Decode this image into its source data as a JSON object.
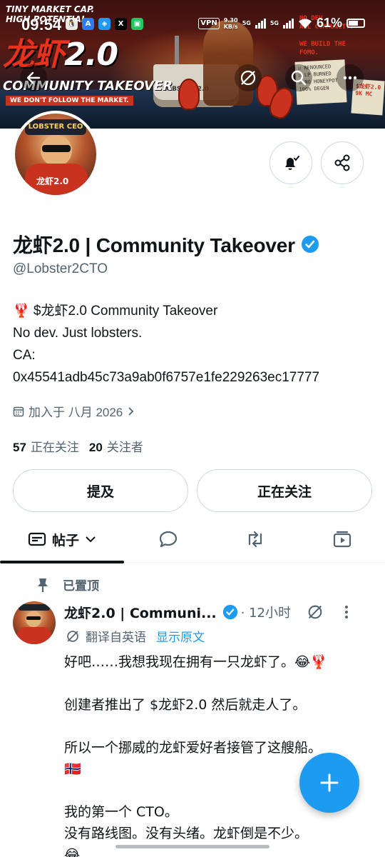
{
  "status_bar": {
    "time": "09:54",
    "apps": [
      "🐧",
      "A",
      "◈",
      "X",
      "▣"
    ],
    "vpn": "VPN",
    "speed_value": "9.30",
    "speed_unit": "KB/s",
    "net1": "5G",
    "net2": "5G",
    "battery": "61%"
  },
  "banner": {
    "tagline_top": "TINY MARKET CAP.\nHIGH POTENTIAL",
    "title_red": "龙虾",
    "title_white": "2.0",
    "subtitle": "COMMUNITY TAKEOVER",
    "redbar": "WE DON'T FOLLOW THE MARKET.",
    "notes": "NO DEV.\nALL COMMUNITY.\n\nWE BUILD THE FOMO.",
    "note_pad": "☑ RENOUNCED\n☑ LP BURNED\n☑ NO HONEYPOT\n100% DEGEN",
    "sticky": "$龙虾2.0\n9K MC",
    "ship_label": "LOBSTER 2.0",
    "avatar_hat": "LOBSTER CEO",
    "avatar_tag": "龙虾2.0"
  },
  "profile": {
    "display_name": "龙虾2.0 | Community Takeover",
    "handle": "@Lobster2CTO",
    "bio_line1": "🦞 $龙虾2.0 Community Takeover",
    "bio_line2": "No dev. Just lobsters.",
    "bio_line3": "CA:",
    "bio_line4": "0x45541adb45c73a9ab0f6757e1fe229263ec17777",
    "joined": "加入于 八月 2026",
    "following_count": "57",
    "following_label": "正在关注",
    "followers_count": "20",
    "followers_label": "关注者"
  },
  "actions": {
    "mention": "提及",
    "following": "正在关注"
  },
  "tabs": {
    "posts": "帖子"
  },
  "post": {
    "pinned_label": "已置顶",
    "author": "龙虾2.0 | Communi...",
    "time": "· 12小时",
    "translated_label": "翻译自英语",
    "show_original": "显示原文",
    "body": "好吧……我想我现在拥有一只龙虾了。😂🦞\n\n创建者推出了 $龙虾2.0 然后就走人了。\n\n所以一个挪威的龙虾爱好者接管了这艘船。\n🇳🇴\n\n我的第一个 CTO。\n没有路线图。没有头绪。龙虾倒是不少。\n😂"
  },
  "colors": {
    "accent": "#1d9bf0",
    "text": "#0f1419",
    "muted": "#536471",
    "border": "#cfd9de"
  }
}
